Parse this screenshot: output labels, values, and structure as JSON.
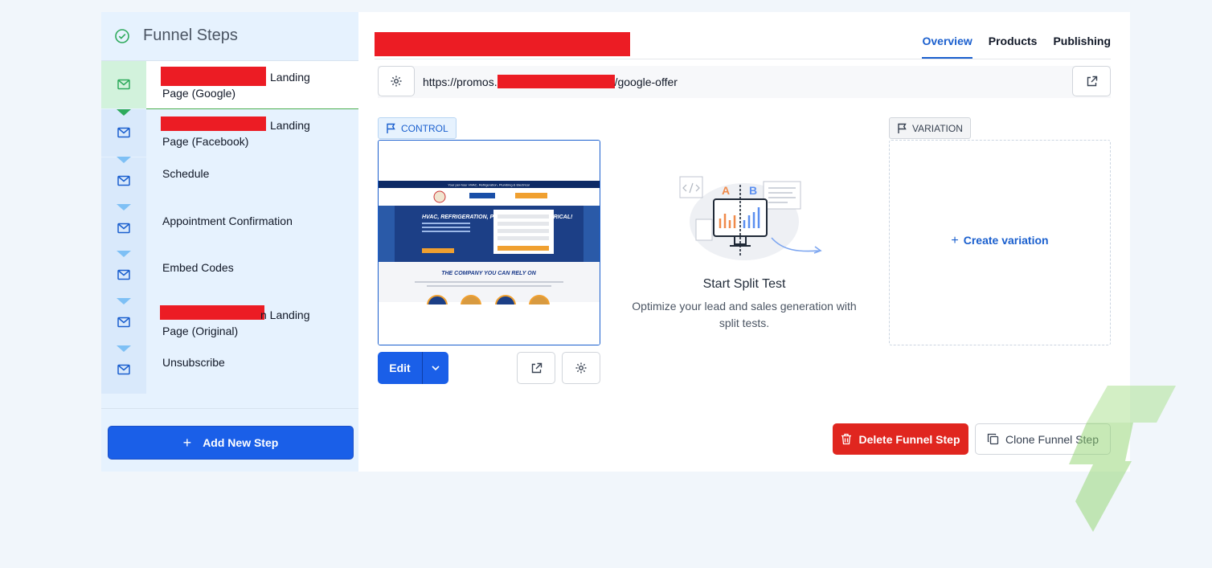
{
  "sidebar": {
    "title": "Funnel Steps",
    "steps": [
      {
        "label_line1": "Landing",
        "label_line2": "Page (Google)",
        "active": true
      },
      {
        "label_line1": "Landing",
        "label_line2": "Page (Facebook)"
      },
      {
        "label_line1": "Schedule",
        "label_line2": ""
      },
      {
        "label_line1": "Appointment Confirmation",
        "label_line2": ""
      },
      {
        "label_line1": "Embed Codes",
        "label_line2": ""
      },
      {
        "label_line1": "n Landing",
        "label_line2": "Page (Original)"
      },
      {
        "label_line1": "Unsubscribe",
        "label_line2": ""
      }
    ],
    "add_button": "Add New Step"
  },
  "tabs": [
    "Overview",
    "Products",
    "Publishing"
  ],
  "url": {
    "prefix": "https://promos.",
    "suffix": "/google-offer"
  },
  "control_label": "CONTROL",
  "variation_label": "VARIATION",
  "edit_label": "Edit",
  "split_test": {
    "title": "Start Split Test",
    "description": "Optimize your lead and sales generation with split tests."
  },
  "create_variation": "Create variation",
  "preview": {
    "banner": "Your per-hour HVAC, Refrigeration, Plumbing & Electrical",
    "headline": "HVAC, REFRIGERATION, PLUMBING AND ELECTRICAL!",
    "tagline": "THE COMPANY YOU CAN RELY ON"
  },
  "actions": {
    "delete": "Delete Funnel Step",
    "clone": "Clone Funnel Step"
  },
  "colors": {
    "primary": "#1a5fe8",
    "danger": "#e0261f",
    "success": "#2eaa5c"
  }
}
